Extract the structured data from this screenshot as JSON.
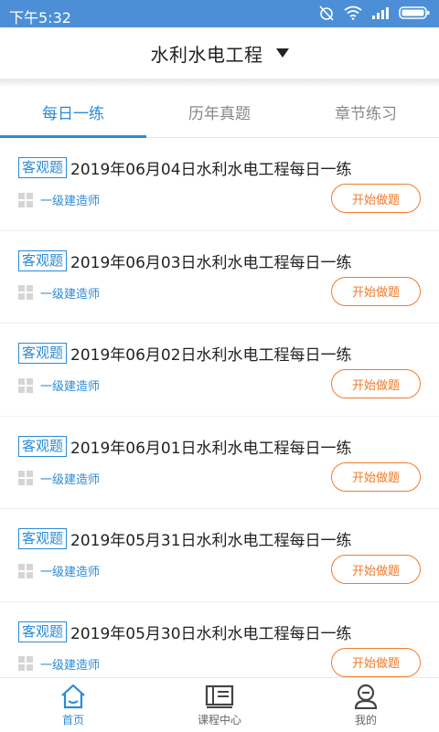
{
  "status": {
    "time": "下午5:32"
  },
  "header": {
    "title": "水利水电工程"
  },
  "tabs": [
    {
      "label": "每日一练",
      "active": true
    },
    {
      "label": "历年真题",
      "active": false
    },
    {
      "label": "章节练习",
      "active": false
    }
  ],
  "items": [
    {
      "badge": "客观题",
      "title": "2019年06月04日水利水电工程每日一练",
      "category": "一级建造师",
      "button": "开始做题"
    },
    {
      "badge": "客观题",
      "title": "2019年06月03日水利水电工程每日一练",
      "category": "一级建造师",
      "button": "开始做题"
    },
    {
      "badge": "客观题",
      "title": "2019年06月02日水利水电工程每日一练",
      "category": "一级建造师",
      "button": "开始做题"
    },
    {
      "badge": "客观题",
      "title": "2019年06月01日水利水电工程每日一练",
      "category": "一级建造师",
      "button": "开始做题"
    },
    {
      "badge": "客观题",
      "title": "2019年05月31日水利水电工程每日一练",
      "category": "一级建造师",
      "button": "开始做题"
    },
    {
      "badge": "客观题",
      "title": "2019年05月30日水利水电工程每日一练",
      "category": "一级建造师",
      "button": "开始做题"
    }
  ],
  "nav": [
    {
      "label": "首页",
      "icon": "home-icon",
      "active": true
    },
    {
      "label": "课程中心",
      "icon": "course-icon",
      "active": false
    },
    {
      "label": "我的",
      "icon": "profile-icon",
      "active": false
    }
  ],
  "colors": {
    "accent": "#2b8ad6",
    "statusbar": "#4d8fd6",
    "button": "#f07a2b"
  }
}
